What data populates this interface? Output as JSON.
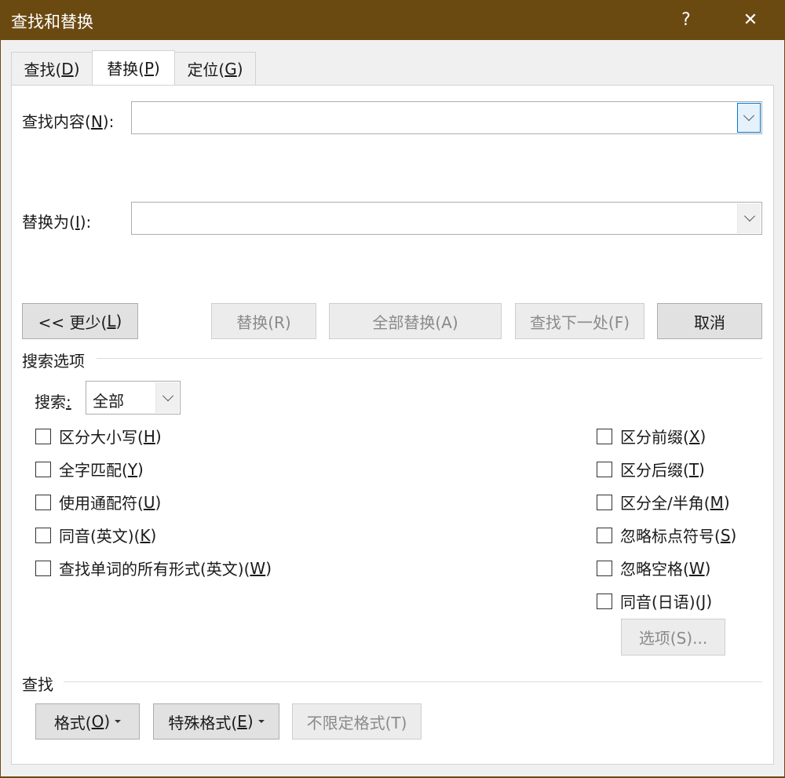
{
  "window": {
    "title": "查找和替换",
    "help": "?",
    "close": "✕"
  },
  "tabs": [
    {
      "label": "查找(",
      "key": "D",
      "close": ")"
    },
    {
      "label": "替换(",
      "key": "P",
      "close": ")"
    },
    {
      "label": "定位(",
      "key": "G",
      "close": ")"
    }
  ],
  "find": {
    "label": "查找内容(",
    "key": "N",
    "close": "):",
    "value": ""
  },
  "replace": {
    "label": "替换为(",
    "key": "I",
    "close": "):",
    "value": ""
  },
  "buttons": {
    "less_prefix": "<< 更少(",
    "less_key": "L",
    "less_close": ")",
    "replace": "替换(R)",
    "replace_all": "全部替换(A)",
    "find_next": "查找下一处(F)",
    "cancel": "取消"
  },
  "search_options": {
    "group_label": "搜索选项",
    "search_label": "搜索",
    "search_colon": ":",
    "search_value": "全部",
    "left": [
      {
        "label": "区分大小写(",
        "key": "H",
        "close": ")"
      },
      {
        "label": "全字匹配(",
        "key": "Y",
        "close": ")"
      },
      {
        "label": "使用通配符(",
        "key": "U",
        "close": ")"
      },
      {
        "label": "同音(英文)(",
        "key": "K",
        "close": ")"
      },
      {
        "label": "查找单词的所有形式(英文)(",
        "key": "W",
        "close": ")"
      }
    ],
    "right": [
      {
        "label": "区分前缀(",
        "key": "X",
        "close": ")"
      },
      {
        "label": "区分后缀(",
        "key": "T",
        "close": ")"
      },
      {
        "label": "区分全/半角(",
        "key": "M",
        "close": ")"
      },
      {
        "label": "忽略标点符号(",
        "key": "S",
        "close": ")"
      },
      {
        "label": "忽略空格(",
        "key": "W",
        "close": ")"
      },
      {
        "label": "同音(日语)(",
        "key": "J",
        "close": ")"
      }
    ],
    "options_button": "选项(S)..."
  },
  "find_group": {
    "label": "查找",
    "format_label": "格式(",
    "format_key": "O",
    "format_close": ")",
    "special_label": "特殊格式(",
    "special_key": "E",
    "special_close": ")",
    "no_format": "不限定格式(T)"
  }
}
